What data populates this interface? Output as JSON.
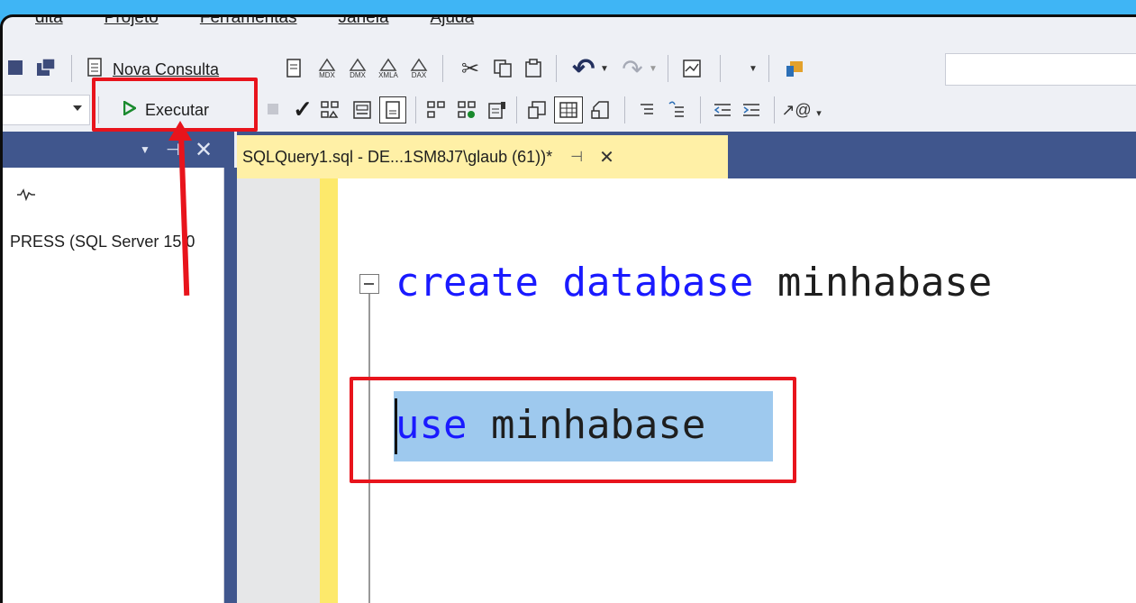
{
  "menu": [
    "dita",
    "Projeto",
    "Ferramentas",
    "Janela",
    "Ajuda"
  ],
  "toolbar1": {
    "new_query_label": "Nova Consulta",
    "mdx": "MDX",
    "dmx": "DMX",
    "xmla": "XMLA",
    "dax": "DAX"
  },
  "toolbar2": {
    "execute_label": "Executar"
  },
  "object_explorer": {
    "server_text": "PRESS (SQL Server 15.0"
  },
  "tab": {
    "title": "SQLQuery1.sql - DE...1SM8J7\\glaub (61))*"
  },
  "editor": {
    "line1_keyword1": "create",
    "line1_keyword2": "database",
    "line1_name": "minhabase",
    "line2_keyword": "use",
    "line2_name": "minhabase"
  },
  "colors": {
    "highlight": "#e8141c",
    "keyword": "#1a1aff",
    "selection": "#9ec9ee",
    "tab_active": "#fff0a6",
    "panel_header": "#40568d"
  }
}
